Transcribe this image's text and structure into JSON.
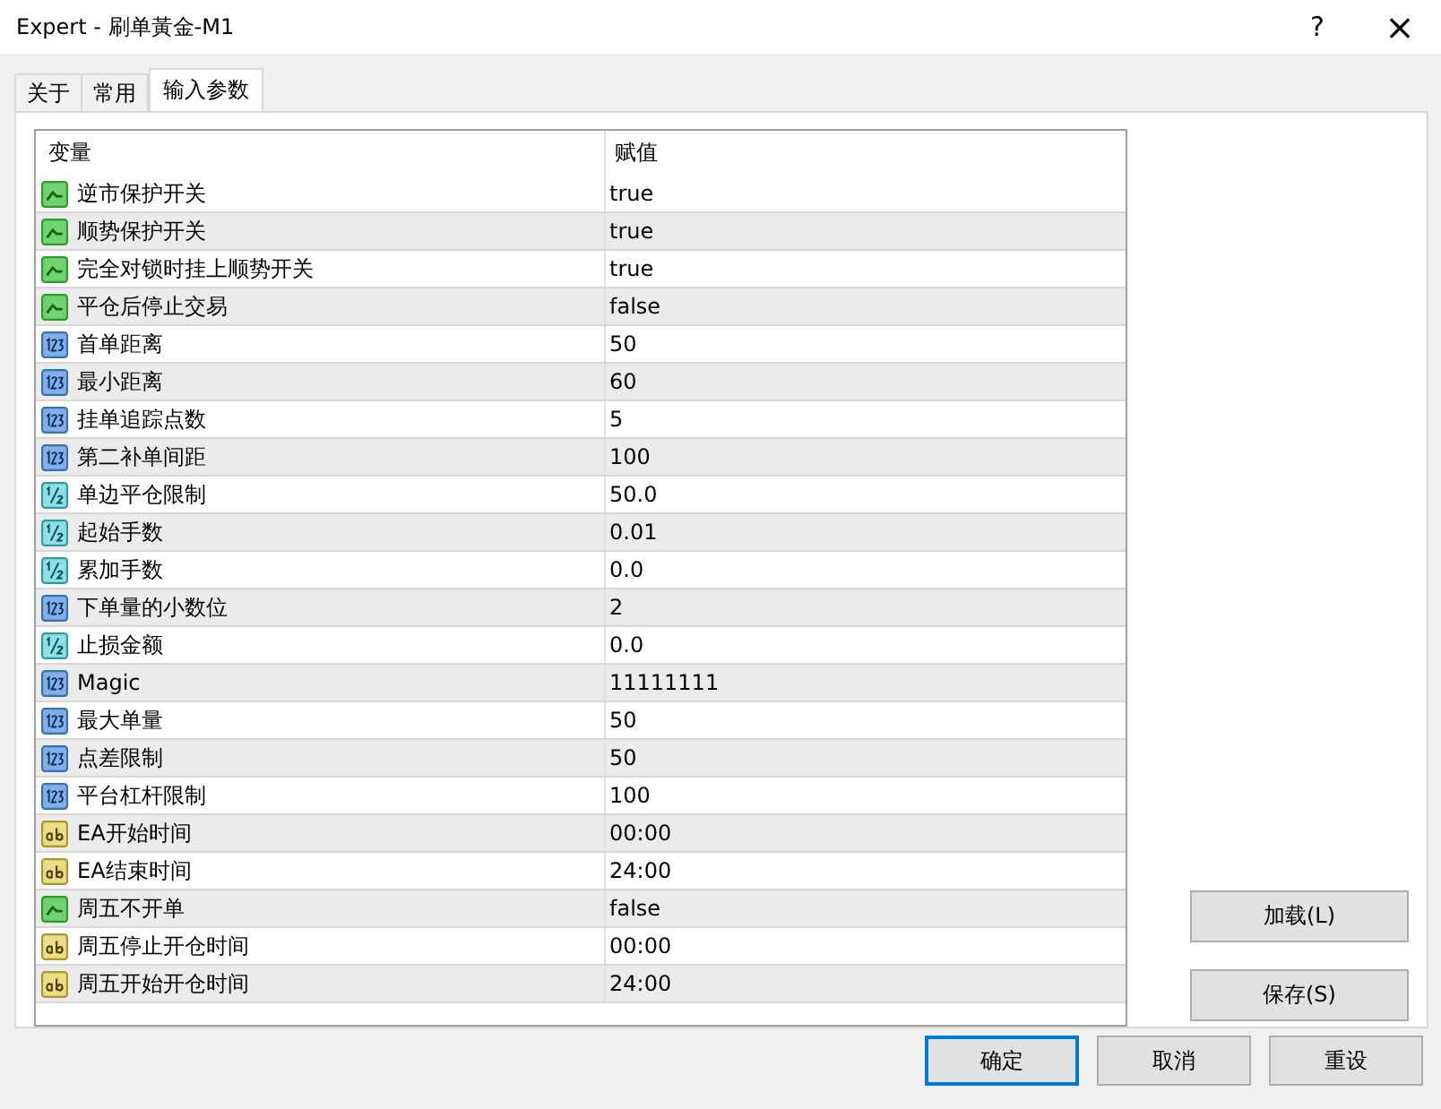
{
  "window": {
    "title": "Expert - 刷单黃金-M1",
    "help": "?",
    "close": "×"
  },
  "tabs": [
    {
      "label": "关于",
      "selected": false
    },
    {
      "label": "常用",
      "selected": false
    },
    {
      "label": "输入参数",
      "selected": true
    }
  ],
  "table": {
    "columns": [
      "变量",
      "赋值"
    ],
    "rows": [
      {
        "kind": "bool",
        "name": "逆市保护开关",
        "value": "true"
      },
      {
        "kind": "bool",
        "name": "顺势保护开关",
        "value": "true"
      },
      {
        "kind": "bool",
        "name": "完全对锁时挂上顺势开关",
        "value": "true"
      },
      {
        "kind": "bool",
        "name": "平仓后停止交易",
        "value": "false"
      },
      {
        "kind": "int",
        "name": "首单距离",
        "value": "50"
      },
      {
        "kind": "int",
        "name": "最小距离",
        "value": "60"
      },
      {
        "kind": "int",
        "name": "挂单追踪点数",
        "value": "5"
      },
      {
        "kind": "int",
        "name": "第二补单间距",
        "value": "100"
      },
      {
        "kind": "double",
        "name": "单边平仓限制",
        "value": "50.0"
      },
      {
        "kind": "double",
        "name": "起始手数",
        "value": "0.01"
      },
      {
        "kind": "double",
        "name": "累加手数",
        "value": "0.0"
      },
      {
        "kind": "int",
        "name": "下单量的小数位",
        "value": "2"
      },
      {
        "kind": "double",
        "name": "止损金额",
        "value": "0.0"
      },
      {
        "kind": "int",
        "name": "Magic",
        "value": "11111111"
      },
      {
        "kind": "int",
        "name": "最大单量",
        "value": "50"
      },
      {
        "kind": "int",
        "name": "点差限制",
        "value": "50"
      },
      {
        "kind": "int",
        "name": "平台杠杆限制",
        "value": "100"
      },
      {
        "kind": "string",
        "name": "EA开始时间",
        "value": "00:00"
      },
      {
        "kind": "string",
        "name": "EA结束时间",
        "value": "24:00"
      },
      {
        "kind": "bool",
        "name": "周五不开单",
        "value": "false"
      },
      {
        "kind": "string",
        "name": "周五停止开仓时间",
        "value": "00:00"
      },
      {
        "kind": "string",
        "name": "周五开始开仓时间",
        "value": "24:00"
      }
    ]
  },
  "side_buttons": [
    "加载(L)",
    "保存(S)"
  ],
  "footer_buttons": [
    {
      "label": "确定",
      "selected": true
    },
    {
      "label": "取消",
      "selected": false
    },
    {
      "label": "重设",
      "selected": false
    }
  ]
}
